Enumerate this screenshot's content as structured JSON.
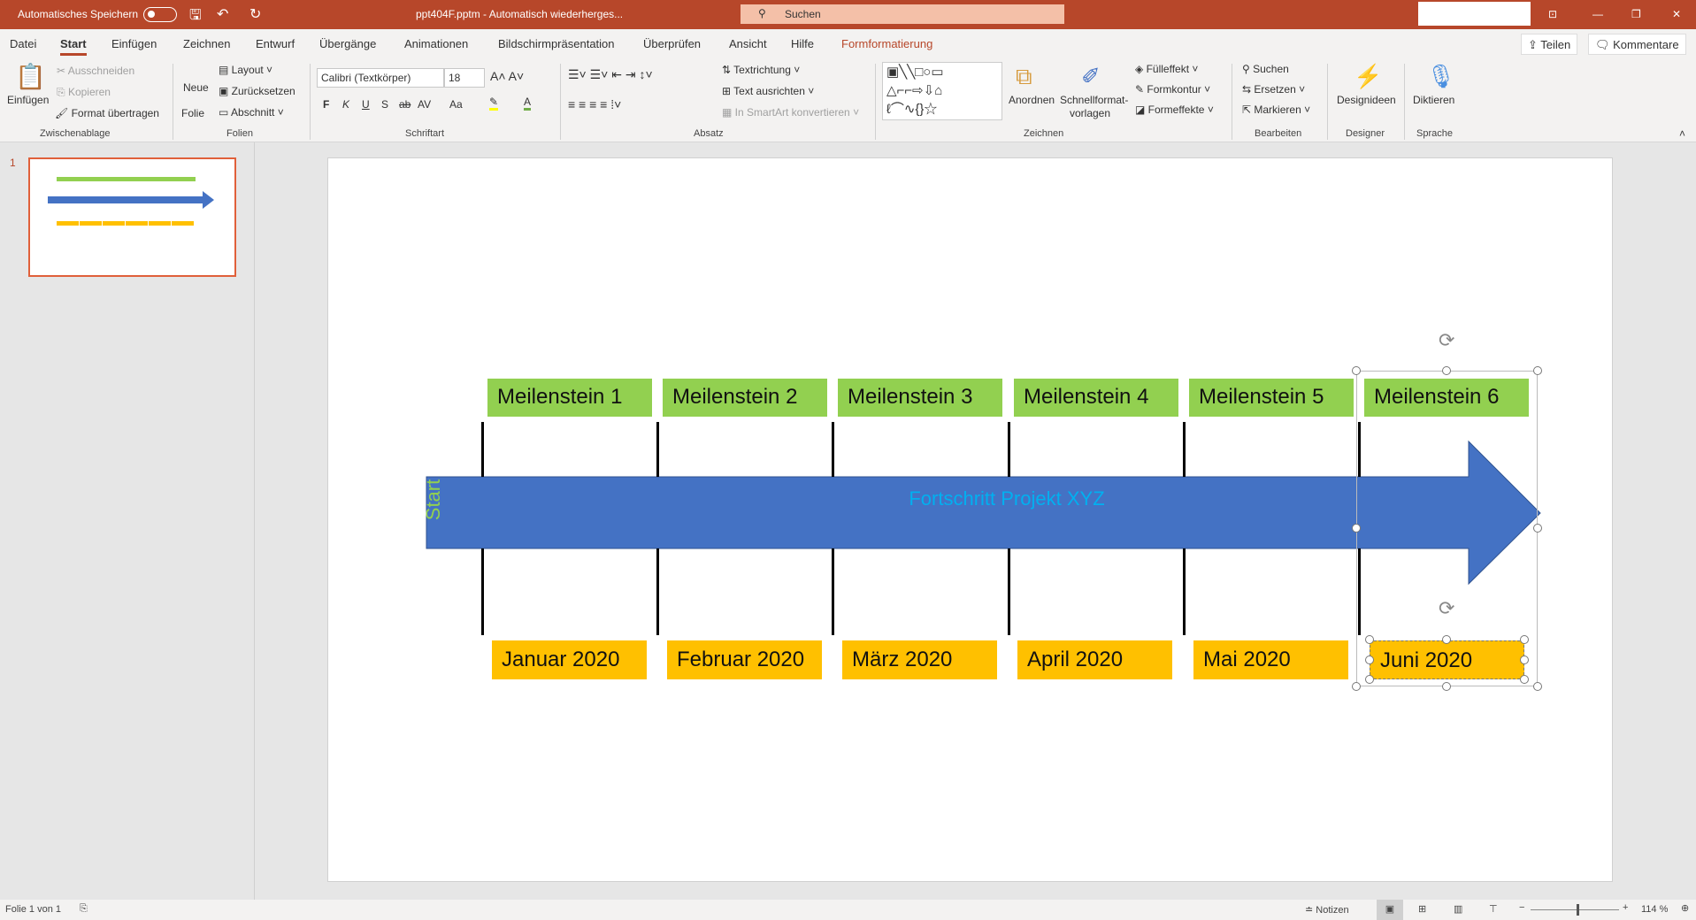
{
  "titlebar": {
    "autosave": "Automatisches Speichern",
    "filename": "ppt404F.pptm  -  Automatisch wiederherges...",
    "search": "Suchen"
  },
  "tabs": [
    "Datei",
    "Start",
    "Einfügen",
    "Zeichnen",
    "Entwurf",
    "Übergänge",
    "Animationen",
    "Bildschirmpräsentation",
    "Überprüfen",
    "Ansicht",
    "Hilfe",
    "Formformatierung"
  ],
  "share": "Teilen",
  "comments": "Kommentare",
  "ribbon": {
    "clipboard": {
      "paste": "Einfügen",
      "cut": "Ausschneiden",
      "copy": "Kopieren",
      "format_painter": "Format übertragen",
      "group": "Zwischenablage"
    },
    "slides": {
      "new_slide": "Neue",
      "new_slide2": "Folie",
      "layout": "Layout",
      "reset": "Zurücksetzen",
      "section": "Abschnitt",
      "group": "Folien"
    },
    "font": {
      "name": "Calibri (Textkörper)",
      "size": "18",
      "bold": "F",
      "italic": "K",
      "underline": "U",
      "shadow": "S",
      "strike": "ab",
      "spacing": "AV",
      "case": "Aa",
      "group": "Schriftart"
    },
    "paragraph": {
      "text_direction": "Textrichtung",
      "align_text": "Text ausrichten",
      "smartart": "In SmartArt konvertieren",
      "group": "Absatz"
    },
    "drawing": {
      "arrange": "Anordnen",
      "quick_styles": "Schnellformat-",
      "quick_styles2": "vorlagen",
      "fill": "Fülleffekt",
      "outline": "Formkontur",
      "effects": "Formeffekte",
      "group": "Zeichnen"
    },
    "editing": {
      "find": "Suchen",
      "replace": "Ersetzen",
      "select": "Markieren",
      "group": "Bearbeiten"
    },
    "designer": {
      "ideas": "Designideen",
      "group": "Designer"
    },
    "voice": {
      "dictate": "Diktieren",
      "group": "Sprache"
    }
  },
  "slide_number": "1",
  "slide": {
    "milestones": [
      "Meilenstein 1",
      "Meilenstein 2",
      "Meilenstein 3",
      "Meilenstein 4",
      "Meilenstein 5",
      "Meilenstein 6"
    ],
    "dates": [
      "Januar 2020",
      "Februar 2020",
      "März 2020",
      "April 2020",
      "Mai 2020",
      "Juni 2020"
    ],
    "arrow_label": "Fortschritt Projekt XYZ",
    "start_label": "Start"
  },
  "status": {
    "slide_info": "Folie 1 von 1",
    "notes": "Notizen",
    "zoom": "114 %"
  }
}
